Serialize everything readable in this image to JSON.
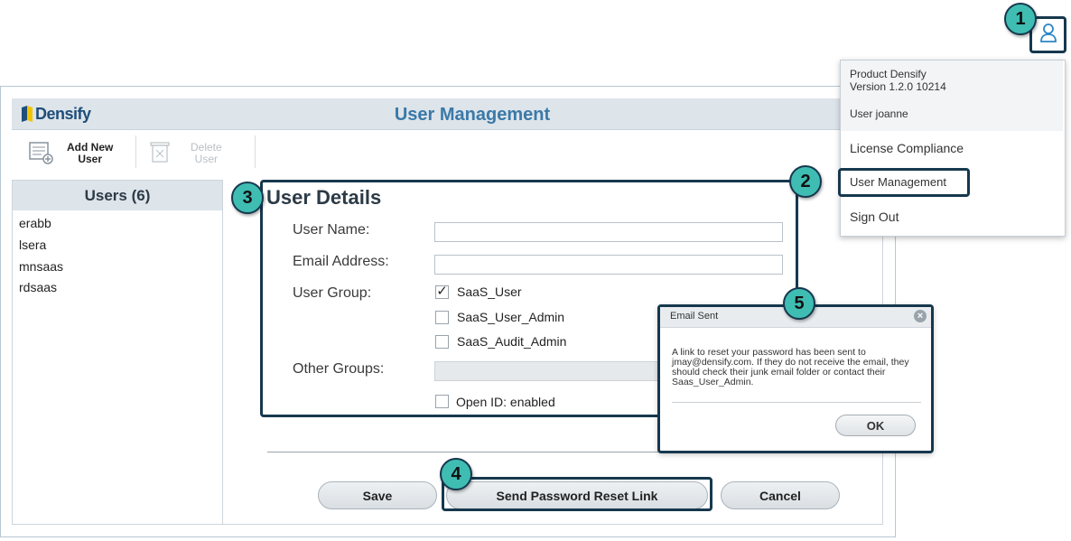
{
  "app": {
    "logo_text": "Densify",
    "title": "User Management"
  },
  "toolbar": {
    "add_user": {
      "line1": "Add New",
      "line2": "User"
    },
    "delete_user": {
      "line1": "Delete",
      "line2": "User"
    }
  },
  "users": {
    "header": "Users (6)",
    "items": [
      "erabb",
      "lsera",
      "mnsaas",
      "rdsaas"
    ]
  },
  "details": {
    "title": "User Details",
    "labels": {
      "user_name": "User Name:",
      "email": "Email Address:",
      "user_group": "User Group:",
      "other_groups": "Other Groups:"
    },
    "user_name_value": "",
    "email_value": "",
    "groups": [
      {
        "label": "SaaS_User",
        "checked": true
      },
      {
        "label": "SaaS_User_Admin",
        "checked": false
      },
      {
        "label": "SaaS_Audit_Admin",
        "checked": false
      }
    ],
    "open_id": {
      "label": "Open ID: enabled",
      "checked": false
    }
  },
  "buttons": {
    "save": "Save",
    "reset": "Send Password Reset Link",
    "cancel": "Cancel"
  },
  "profile_menu": {
    "product": "Product Densify",
    "version": "Version 1.2.0 10214",
    "user": "User joanne",
    "items": [
      "License Compliance",
      "User Management",
      "Sign Out"
    ]
  },
  "dialog": {
    "title": "Email Sent",
    "message": "A link to reset your password has been sent to jmay@densify.com. If they do not receive the email, they should check their junk email folder or contact their Saas_User_Admin.",
    "ok": "OK"
  },
  "callouts": [
    "1",
    "2",
    "3",
    "4",
    "5"
  ],
  "colors": {
    "accent_teal": "#3fbdb3",
    "highlight_border": "#16384e",
    "title_blue": "#3a79a8"
  }
}
